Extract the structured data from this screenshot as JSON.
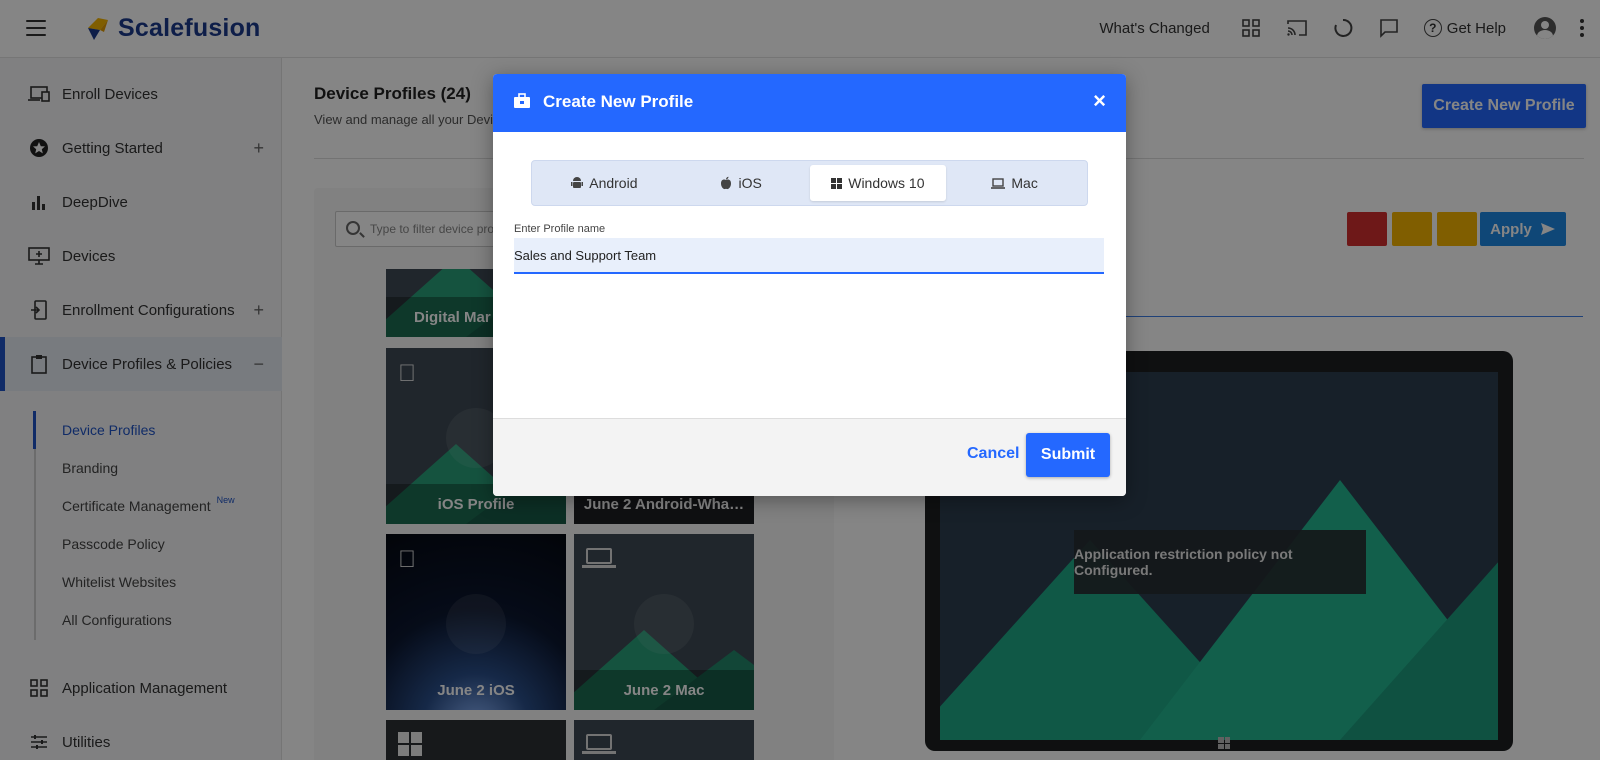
{
  "brand": {
    "name": "Scalefusion"
  },
  "header": {
    "whats_changed": "What's Changed",
    "get_help": "Get Help",
    "icons": [
      "grid-icon",
      "cast-icon",
      "loading-icon",
      "chat-icon",
      "help-icon",
      "account-icon",
      "more-icon"
    ]
  },
  "sidebar": {
    "items": [
      {
        "label": "Enroll Devices",
        "icon": "devices-icon"
      },
      {
        "label": "Getting Started",
        "icon": "star-icon",
        "expand": "+"
      },
      {
        "label": "DeepDive",
        "icon": "bar-chart-icon"
      },
      {
        "label": "Devices",
        "icon": "monitor-icon"
      },
      {
        "label": "Enrollment Configurations",
        "icon": "phone-config-icon",
        "expand": "+"
      },
      {
        "label": "Device Profiles & Policies",
        "icon": "clipboard-icon",
        "expand": "−"
      },
      {
        "label": "Application Management",
        "icon": "apps-grid-icon"
      },
      {
        "label": "Utilities",
        "icon": "sliders-icon"
      }
    ],
    "subitems": [
      {
        "label": "Device Profiles"
      },
      {
        "label": "Branding"
      },
      {
        "label": "Certificate Management",
        "badge": "New"
      },
      {
        "label": "Passcode Policy"
      },
      {
        "label": "Whitelist Websites"
      },
      {
        "label": "All Configurations"
      }
    ]
  },
  "main": {
    "title": "Device Profiles (24)",
    "subtitle": "View and manage all your Devic",
    "create_button": "Create New Profile",
    "filter_placeholder": "Type to filter device pro",
    "apply_button": "Apply",
    "tiles": [
      {
        "caption": "Digital Mar"
      },
      {
        "caption": "iOS Profile"
      },
      {
        "caption": "June 2 Android-Wha…"
      },
      {
        "caption": "June 2 iOS"
      },
      {
        "caption": "June 2 Mac"
      }
    ],
    "preview_message": "Application restriction policy not Configured."
  },
  "modal": {
    "title": "Create New Profile",
    "close": "×",
    "tabs": [
      {
        "label": "Android",
        "icon": "android-icon"
      },
      {
        "label": "iOS",
        "icon": "apple-icon"
      },
      {
        "label": "Windows 10",
        "icon": "windows-icon",
        "selected": true
      },
      {
        "label": "Mac",
        "icon": "laptop-icon"
      }
    ],
    "field_label": "Enter Profile name",
    "field_value": "Sales and Support Team",
    "cancel": "Cancel",
    "submit": "Submit"
  },
  "colors": {
    "primary": "#2468ff",
    "brand_text": "#1b3a8c",
    "delete": "#d32f2f",
    "copy": "#f5b400",
    "edit": "#f5b400",
    "apply": "#1e88e5",
    "sidebar_active": "#1f53c5"
  }
}
